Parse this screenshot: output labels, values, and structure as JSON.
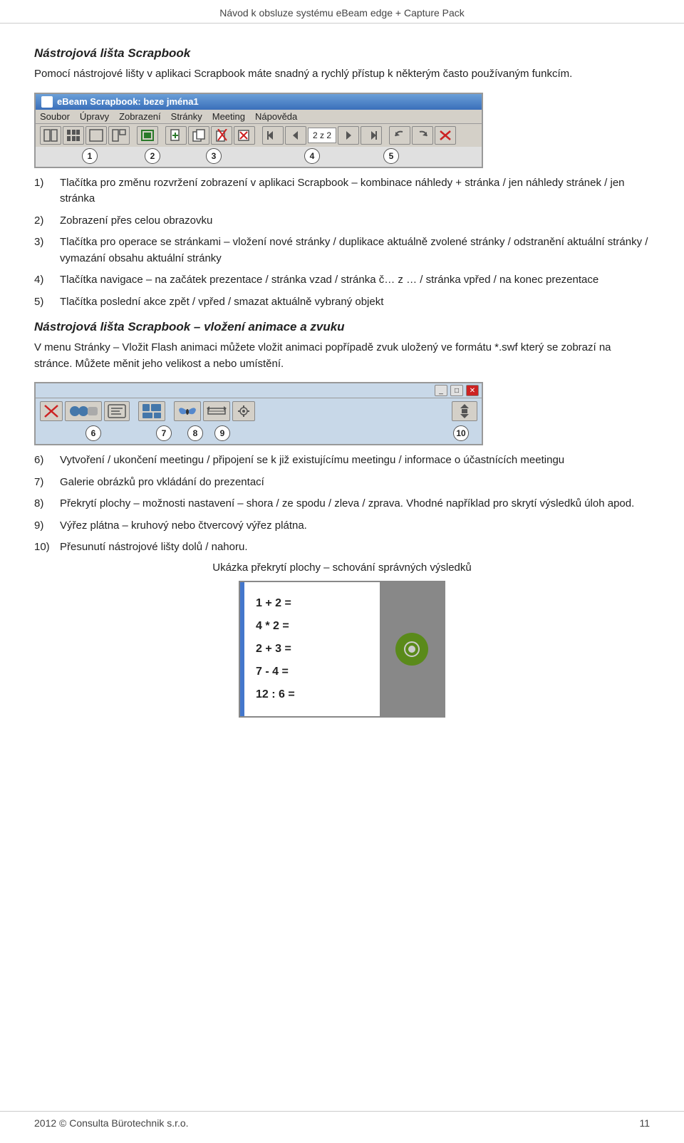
{
  "header": {
    "title": "Návod k obsluze systému eBeam edge + Capture Pack"
  },
  "page_title_h2": "Nástrojová lišta Scrapbook",
  "intro": "Pomocí nástrojové lišty v aplikaci Scrapbook máte snadný a rychlý přístup k některým často používaným funkcím.",
  "toolbar1": {
    "titlebar": "eBeam Scrapbook: beze jména1",
    "menu_items": [
      "Soubor",
      "Úpravy",
      "Zobrazení",
      "Stránky",
      "Meeting",
      "Nápověda"
    ],
    "nav_text": "2 z 2",
    "numbered_labels": [
      "1",
      "2",
      "3",
      "4",
      "5"
    ]
  },
  "list_items": [
    {
      "num": "1)",
      "text": "Tlačítka pro změnu rozvržení zobrazení v aplikaci Scrapbook – kombinace náhledy + stránka / jen náhledy stránek / jen stránka"
    },
    {
      "num": "2)",
      "text": "Zobrazení přes celou obrazovku"
    },
    {
      "num": "3)",
      "text": "Tlačítka pro operace se stránkami – vložení nové stránky / duplikace aktuálně zvolené stránky / odstranění aktuální stránky / vymazání obsahu aktuální stránky"
    },
    {
      "num": "4)",
      "text": "Tlačítka navigace – na začátek prezentace / stránka vzad / stránka č… z … / stránka vpřed / na konec prezentace"
    },
    {
      "num": "5)",
      "text": "Tlačítka poslední akce zpět / vpřed / smazat aktuálně vybraný objekt"
    }
  ],
  "section2_title": "Nástrojová lišta Scrapbook – vložení animace a zvuku",
  "section2_intro": "V menu Stránky – Vložit Flash animaci můžete vložit animaci popřípadě zvuk uložený ve formátu *.swf který se zobrazí na stránce. Můžete měnit jeho velikost a nebo umístění.",
  "toolbar2": {
    "numbered_labels": [
      "6",
      "7",
      "8",
      "9",
      "10"
    ]
  },
  "list_items2": [
    {
      "num": "6)",
      "text": "Vytvoření / ukončení meetingu / připojení se k již existujícímu meetingu / informace o účastnících meetingu"
    },
    {
      "num": "7)",
      "text": "Galerie obrázků pro vkládání do prezentací"
    },
    {
      "num": "8)",
      "text": "Překrytí plochy – možnosti nastavení – shora / ze spodu / zleva / zprava. Vhodné například pro skrytí výsledků úloh apod."
    },
    {
      "num": "9)",
      "text": "Výřez plátna – kruhový nebo čtvercový výřez plátna."
    },
    {
      "num": "10)",
      "text": "Přesunutí nástrojové lišty dolů / nahoru."
    }
  ],
  "caption": "Ukázka překrytí plochy – schování správných výsledků",
  "math_lines": [
    "1 + 2 =",
    "4 * 2 =",
    "2 + 3 =",
    "7 - 4 =",
    "12 : 6 ="
  ],
  "footer": {
    "left": "2012 © Consulta Bürotechnik s.r.o.",
    "right": "11"
  }
}
